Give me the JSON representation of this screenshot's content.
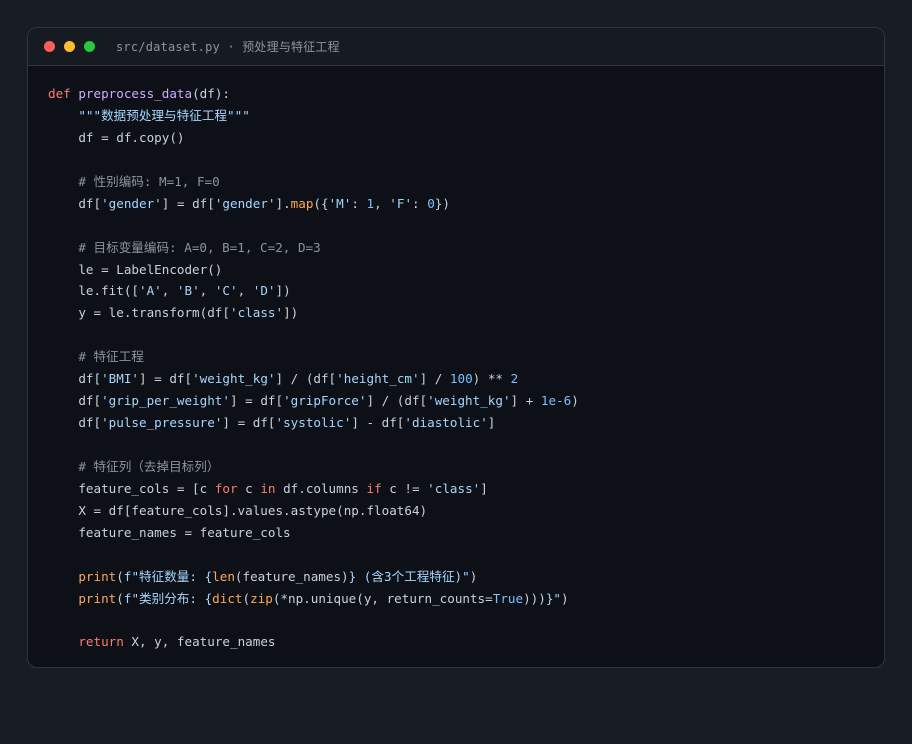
{
  "window": {
    "title": "src/dataset.py · 预处理与特征工程",
    "buttons": {
      "close_color": "#ff5f56",
      "minimize_color": "#ffbd2e",
      "maximize_color": "#27c93f"
    }
  },
  "theme": {
    "keyword": "#ff7b72",
    "function": "#d2a8ff",
    "builtin": "#ffa657",
    "string": "#a5d6ff",
    "number": "#79c0ff",
    "comment": "#8b949e",
    "plain": "#c9d1d9"
  },
  "code_lines": [
    [
      [
        "kw",
        "def"
      ],
      [
        "pl",
        " "
      ],
      [
        "fn",
        "preprocess_data"
      ],
      [
        "pl",
        "(df):"
      ]
    ],
    [
      [
        "pl",
        "    "
      ],
      [
        "str",
        "\"\"\"数据预处理与特征工程\"\"\""
      ]
    ],
    [
      [
        "pl",
        "    df = df.copy()"
      ]
    ],
    [],
    [
      [
        "pl",
        "    "
      ],
      [
        "cm",
        "# 性别编码: M=1, F=0"
      ]
    ],
    [
      [
        "pl",
        "    df["
      ],
      [
        "str",
        "'gender'"
      ],
      [
        "pl",
        "] = df["
      ],
      [
        "str",
        "'gender'"
      ],
      [
        "pl",
        "]."
      ],
      [
        "bi",
        "map"
      ],
      [
        "pl",
        "({"
      ],
      [
        "str",
        "'M'"
      ],
      [
        "pl",
        ": "
      ],
      [
        "num",
        "1"
      ],
      [
        "pl",
        ", "
      ],
      [
        "str",
        "'F'"
      ],
      [
        "pl",
        ": "
      ],
      [
        "num",
        "0"
      ],
      [
        "pl",
        "})"
      ]
    ],
    [],
    [
      [
        "pl",
        "    "
      ],
      [
        "cm",
        "# 目标变量编码: A=0, B=1, C=2, D=3"
      ]
    ],
    [
      [
        "pl",
        "    le = LabelEncoder()"
      ]
    ],
    [
      [
        "pl",
        "    le.fit(["
      ],
      [
        "str",
        "'A'"
      ],
      [
        "pl",
        ", "
      ],
      [
        "str",
        "'B'"
      ],
      [
        "pl",
        ", "
      ],
      [
        "str",
        "'C'"
      ],
      [
        "pl",
        ", "
      ],
      [
        "str",
        "'D'"
      ],
      [
        "pl",
        "])"
      ]
    ],
    [
      [
        "pl",
        "    y = le.transform(df["
      ],
      [
        "str",
        "'class'"
      ],
      [
        "pl",
        "])"
      ]
    ],
    [],
    [
      [
        "pl",
        "    "
      ],
      [
        "cm",
        "# 特征工程"
      ]
    ],
    [
      [
        "pl",
        "    df["
      ],
      [
        "str",
        "'BMI'"
      ],
      [
        "pl",
        "] = df["
      ],
      [
        "str",
        "'weight_kg'"
      ],
      [
        "pl",
        "] / (df["
      ],
      [
        "str",
        "'height_cm'"
      ],
      [
        "pl",
        "] / "
      ],
      [
        "num",
        "100"
      ],
      [
        "pl",
        ") ** "
      ],
      [
        "num",
        "2"
      ]
    ],
    [
      [
        "pl",
        "    df["
      ],
      [
        "str",
        "'grip_per_weight'"
      ],
      [
        "pl",
        "] = df["
      ],
      [
        "str",
        "'gripForce'"
      ],
      [
        "pl",
        "] / (df["
      ],
      [
        "str",
        "'weight_kg'"
      ],
      [
        "pl",
        "] + "
      ],
      [
        "num",
        "1e-6"
      ],
      [
        "pl",
        ")"
      ]
    ],
    [
      [
        "pl",
        "    df["
      ],
      [
        "str",
        "'pulse_pressure'"
      ],
      [
        "pl",
        "] = df["
      ],
      [
        "str",
        "'systolic'"
      ],
      [
        "pl",
        "] - df["
      ],
      [
        "str",
        "'diastolic'"
      ],
      [
        "pl",
        "]"
      ]
    ],
    [],
    [
      [
        "pl",
        "    "
      ],
      [
        "cm",
        "# 特征列（去掉目标列）"
      ]
    ],
    [
      [
        "pl",
        "    feature_cols = [c "
      ],
      [
        "kw",
        "for"
      ],
      [
        "pl",
        " c "
      ],
      [
        "kw",
        "in"
      ],
      [
        "pl",
        " df.columns "
      ],
      [
        "kw",
        "if"
      ],
      [
        "pl",
        " c != "
      ],
      [
        "str",
        "'class'"
      ],
      [
        "pl",
        "]"
      ]
    ],
    [
      [
        "pl",
        "    X = df[feature_cols].values.astype(np.float64)"
      ]
    ],
    [
      [
        "pl",
        "    feature_names = feature_cols"
      ]
    ],
    [],
    [
      [
        "pl",
        "    "
      ],
      [
        "bi",
        "print"
      ],
      [
        "pl",
        "("
      ],
      [
        "str",
        "f\"特征数量: {"
      ],
      [
        "bi",
        "len"
      ],
      [
        "pl",
        "(feature_names)"
      ],
      [
        "str",
        "} (含3个工程特征)\""
      ],
      [
        "pl",
        ")"
      ]
    ],
    [
      [
        "pl",
        "    "
      ],
      [
        "bi",
        "print"
      ],
      [
        "pl",
        "("
      ],
      [
        "str",
        "f\"类别分布: {"
      ],
      [
        "bi",
        "dict"
      ],
      [
        "pl",
        "("
      ],
      [
        "bi",
        "zip"
      ],
      [
        "pl",
        "(*np.unique(y, return_counts="
      ],
      [
        "num",
        "True"
      ],
      [
        "pl",
        ")))"
      ],
      [
        "str",
        "}\""
      ],
      [
        "pl",
        ")"
      ]
    ],
    [],
    [
      [
        "pl",
        "    "
      ],
      [
        "kw",
        "return"
      ],
      [
        "pl",
        " X, y, feature_names"
      ]
    ]
  ]
}
